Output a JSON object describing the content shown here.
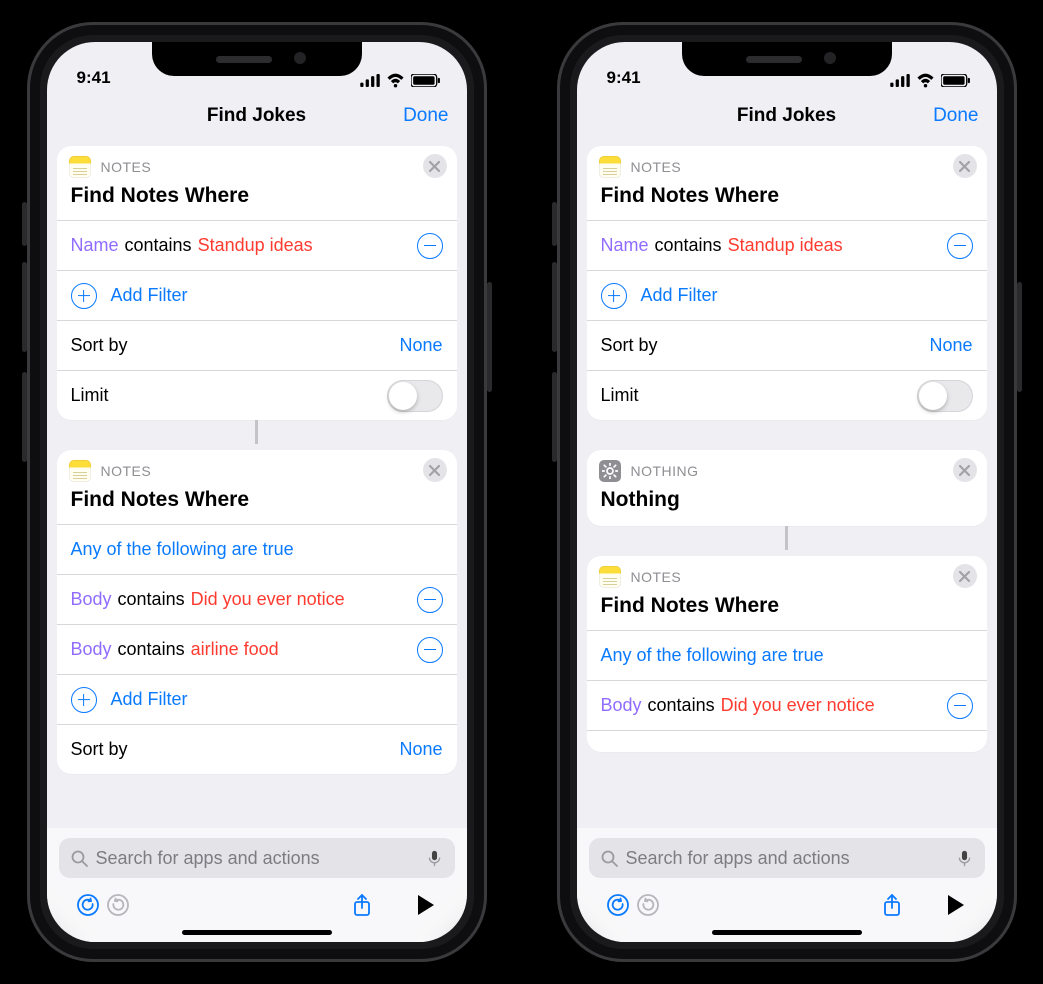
{
  "status": {
    "time": "9:41"
  },
  "nav": {
    "title": "Find Jokes",
    "done": "Done"
  },
  "search": {
    "placeholder": "Search for apps and actions"
  },
  "left": {
    "card1": {
      "app": "NOTES",
      "title": "Find Notes Where",
      "filter1": {
        "field": "Name",
        "op": "contains",
        "value": "Standup ideas"
      },
      "addFilter": "Add Filter",
      "sortLabel": "Sort by",
      "sortValue": "None",
      "limitLabel": "Limit"
    },
    "card2": {
      "app": "NOTES",
      "title": "Find Notes Where",
      "anyTrue": "Any of the following are true",
      "filter1": {
        "field": "Body",
        "op": "contains",
        "value": "Did you ever notice"
      },
      "filter2": {
        "field": "Body",
        "op": "contains",
        "value": "airline food"
      },
      "addFilter": "Add Filter",
      "sortLabel": "Sort by",
      "sortValue": "None"
    }
  },
  "right": {
    "card1": {
      "app": "NOTES",
      "title": "Find Notes Where",
      "filter1": {
        "field": "Name",
        "op": "contains",
        "value": "Standup ideas"
      },
      "addFilter": "Add Filter",
      "sortLabel": "Sort by",
      "sortValue": "None",
      "limitLabel": "Limit"
    },
    "nothing": {
      "app": "NOTHING",
      "title": "Nothing"
    },
    "card3": {
      "app": "NOTES",
      "title": "Find Notes Where",
      "anyTrue": "Any of the following are true",
      "filter1": {
        "field": "Body",
        "op": "contains",
        "value": "Did you ever notice"
      }
    }
  }
}
